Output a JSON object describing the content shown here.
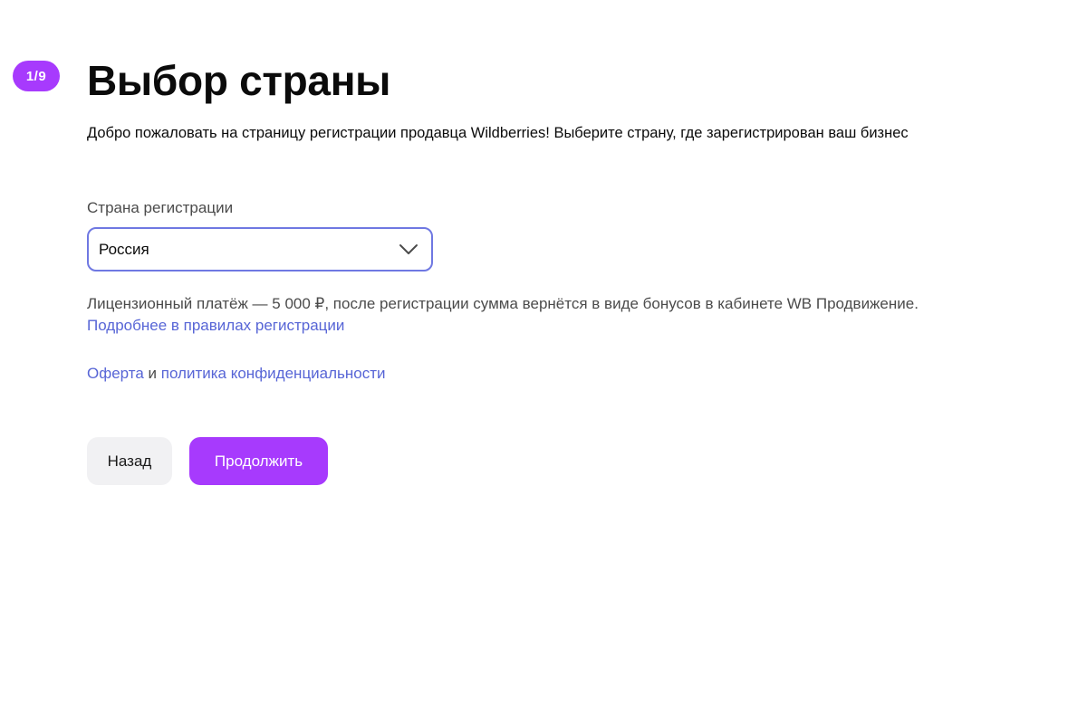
{
  "step": {
    "badge": "1/9"
  },
  "header": {
    "title": "Выбор страны",
    "subtitle": "Добро пожаловать на страницу регистрации продавца Wildberries! Выберите страну, где зарегистрирован ваш бизнес"
  },
  "form": {
    "country_label": "Страна регистрации",
    "country_value": "Россия",
    "chevron_icon": "chevron-down-icon"
  },
  "info": {
    "fee_text": "Лицензионный платёж — 5 000 ₽, после регистрации сумма вернётся в виде бонусов в кабинете WB Продвижение.",
    "rules_link": "Подробнее в правилах регистрации"
  },
  "legal": {
    "offer_link": "Оферта",
    "conjunction": " и ",
    "privacy_link": "политика конфиденциальности"
  },
  "actions": {
    "back_label": "Назад",
    "continue_label": "Продолжить"
  },
  "colors": {
    "accent": "#a73afd",
    "link": "#5765d6",
    "select_border": "#6f78e2",
    "secondary_button": "#f1f1f3"
  }
}
